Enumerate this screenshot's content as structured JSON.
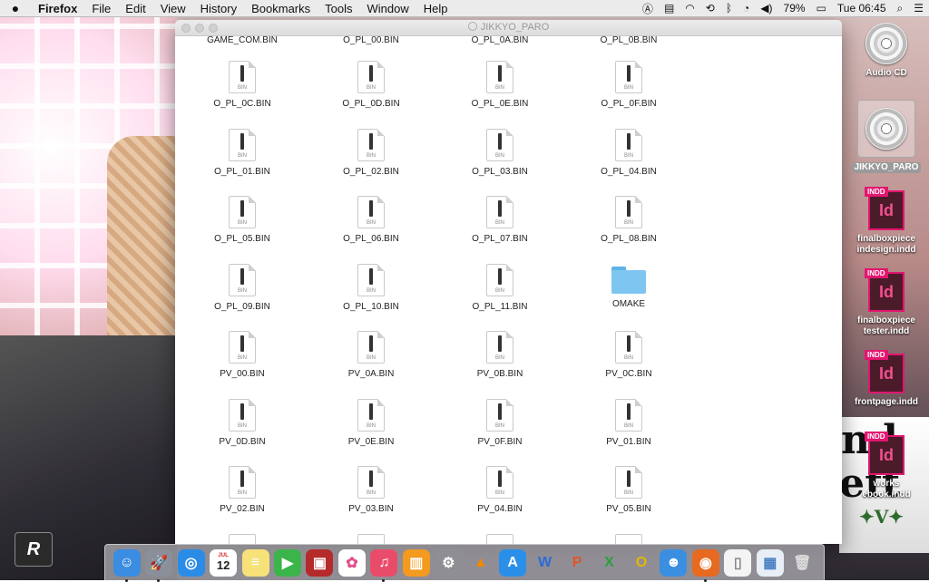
{
  "menubar": {
    "app": "Firefox",
    "menus": [
      "File",
      "Edit",
      "View",
      "History",
      "Bookmarks",
      "Tools",
      "Window",
      "Help"
    ],
    "battery": "79%",
    "clock": "Tue 06:45"
  },
  "window": {
    "title": "JIKKYO_PARO",
    "partial_top_row": [
      "GAME_COM.BIN",
      "O_PL_00.BIN",
      "O_PL_0A.BIN",
      "O_PL_0B.BIN"
    ],
    "rows": [
      [
        "O_PL_0C.BIN",
        "O_PL_0D.BIN",
        "O_PL_0E.BIN",
        "O_PL_0F.BIN"
      ],
      [
        "O_PL_01.BIN",
        "O_PL_02.BIN",
        "O_PL_03.BIN",
        "O_PL_04.BIN"
      ],
      [
        "O_PL_05.BIN",
        "O_PL_06.BIN",
        "O_PL_07.BIN",
        "O_PL_08.BIN"
      ],
      [
        "O_PL_09.BIN",
        "O_PL_10.BIN",
        "O_PL_11.BIN",
        "OMAKE"
      ],
      [
        "PV_00.BIN",
        "PV_0A.BIN",
        "PV_0B.BIN",
        "PV_0C.BIN"
      ],
      [
        "PV_0D.BIN",
        "PV_0E.BIN",
        "PV_0F.BIN",
        "PV_01.BIN"
      ],
      [
        "PV_02.BIN",
        "PV_03.BIN",
        "PV_04.BIN",
        "PV_05.BIN"
      ]
    ],
    "file_ext_badge": "BIN"
  },
  "desktop": {
    "audio_cd": "Audio CD",
    "jikkyo": "JIKKYO_PARO",
    "indd_badge": "INDD",
    "indd_letters": "Id",
    "indd1_line1": "finalboxpiece",
    "indd1_line2": "indesign.indd",
    "indd2_line1": "finalboxpiece",
    "indd2_line2": "tester.indd",
    "indd3": "frontpage.indd",
    "indd4_line1": "works",
    "indd4_line2": "ebook.indd"
  },
  "dock": {
    "items": [
      "finder-icon",
      "launchpad-icon",
      "safari-icon",
      "calendar-icon",
      "notes-icon",
      "facetime-icon",
      "photo-booth-icon",
      "photos-icon",
      "itunes-icon",
      "ibooks-icon",
      "system-preferences-icon",
      "vlc-icon",
      "app-store-icon",
      "word-icon",
      "powerpoint-icon",
      "excel-icon",
      "outlook-icon",
      "messenger-icon",
      "firefox-icon",
      "document-icon",
      "preview-icon",
      "trash-icon"
    ],
    "calendar_month": "JUL",
    "calendar_day": "12"
  },
  "colors": {
    "folder": "#7ec6f1",
    "indesign": "#e3156f"
  }
}
